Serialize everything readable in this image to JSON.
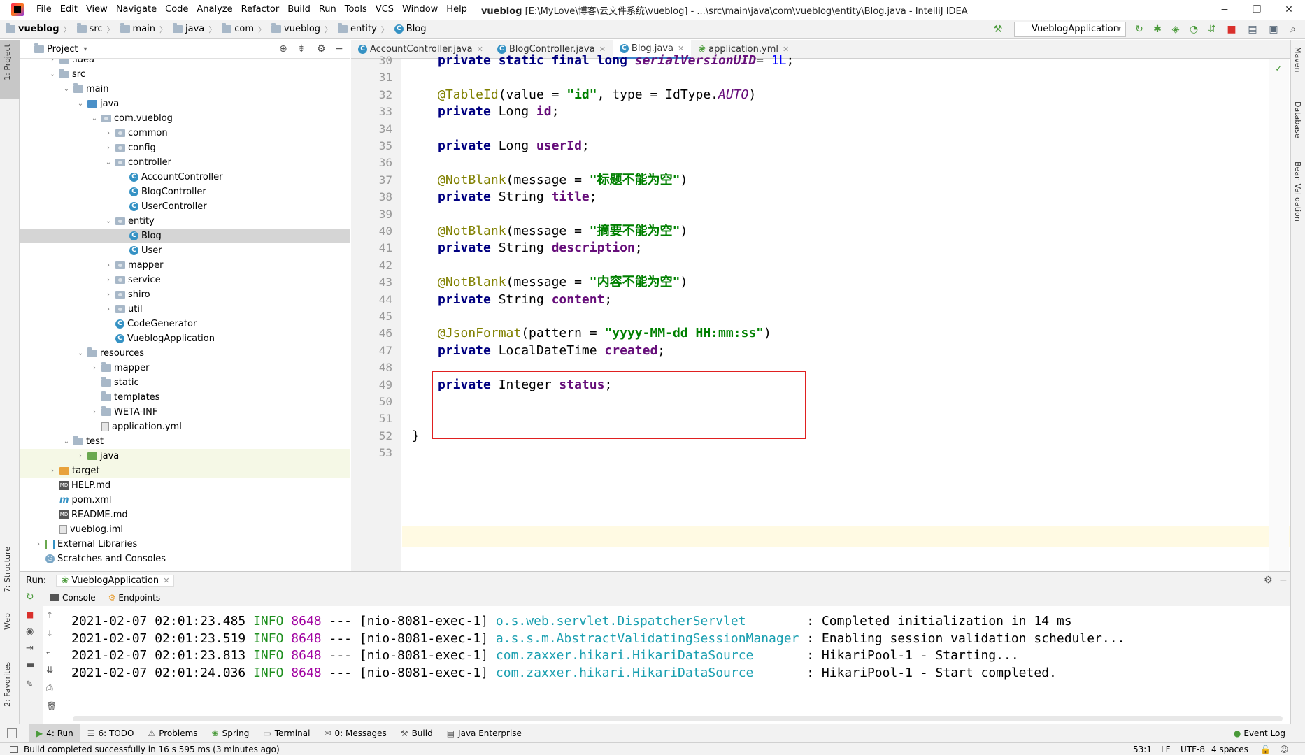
{
  "window": {
    "menu": [
      "File",
      "Edit",
      "View",
      "Navigate",
      "Code",
      "Analyze",
      "Refactor",
      "Build",
      "Run",
      "Tools",
      "VCS",
      "Window",
      "Help"
    ],
    "project_name": "vueblog",
    "title_path": "[E:\\MyLove\\博客\\云文件系统\\vueblog] - ...\\src\\main\\java\\com\\vueblog\\entity\\Blog.java - IntelliJ IDEA",
    "controls": [
      "−",
      "❐",
      "✕"
    ]
  },
  "breadcrumbs": [
    "vueblog",
    "src",
    "main",
    "java",
    "com",
    "vueblog",
    "entity",
    "Blog"
  ],
  "run_config": "VueblogApplication",
  "left_strip": {
    "project": "1: Project",
    "structure": "7: Structure",
    "web": "Web",
    "favorites": "2: Favorites"
  },
  "right_strip": {
    "maven": "Maven",
    "database": "Database",
    "bean": "Bean Validation"
  },
  "project_panel": {
    "title": "Project",
    "tree": [
      {
        "label": ".idea",
        "depth": 1,
        "arrow": "right",
        "icon": "folder"
      },
      {
        "label": "src",
        "depth": 1,
        "arrow": "down",
        "icon": "folder"
      },
      {
        "label": "main",
        "depth": 2,
        "arrow": "down",
        "icon": "folder"
      },
      {
        "label": "java",
        "depth": 3,
        "arrow": "down",
        "icon": "src"
      },
      {
        "label": "com.vueblog",
        "depth": 4,
        "arrow": "down",
        "icon": "pkg"
      },
      {
        "label": "common",
        "depth": 5,
        "arrow": "right",
        "icon": "pkg"
      },
      {
        "label": "config",
        "depth": 5,
        "arrow": "right",
        "icon": "pkg"
      },
      {
        "label": "controller",
        "depth": 5,
        "arrow": "down",
        "icon": "pkg"
      },
      {
        "label": "AccountController",
        "depth": 6,
        "arrow": "none",
        "icon": "class"
      },
      {
        "label": "BlogController",
        "depth": 6,
        "arrow": "none",
        "icon": "class"
      },
      {
        "label": "UserController",
        "depth": 6,
        "arrow": "none",
        "icon": "class"
      },
      {
        "label": "entity",
        "depth": 5,
        "arrow": "down",
        "icon": "pkg"
      },
      {
        "label": "Blog",
        "depth": 6,
        "arrow": "none",
        "icon": "class",
        "selected": true
      },
      {
        "label": "User",
        "depth": 6,
        "arrow": "none",
        "icon": "class"
      },
      {
        "label": "mapper",
        "depth": 5,
        "arrow": "right",
        "icon": "pkg"
      },
      {
        "label": "service",
        "depth": 5,
        "arrow": "right",
        "icon": "pkg"
      },
      {
        "label": "shiro",
        "depth": 5,
        "arrow": "right",
        "icon": "pkg"
      },
      {
        "label": "util",
        "depth": 5,
        "arrow": "right",
        "icon": "pkg"
      },
      {
        "label": "CodeGenerator",
        "depth": 5,
        "arrow": "none",
        "icon": "class"
      },
      {
        "label": "VueblogApplication",
        "depth": 5,
        "arrow": "none",
        "icon": "class"
      },
      {
        "label": "resources",
        "depth": 3,
        "arrow": "down",
        "icon": "folder"
      },
      {
        "label": "mapper",
        "depth": 4,
        "arrow": "right",
        "icon": "folder"
      },
      {
        "label": "static",
        "depth": 4,
        "arrow": "none",
        "icon": "folder"
      },
      {
        "label": "templates",
        "depth": 4,
        "arrow": "none",
        "icon": "folder"
      },
      {
        "label": "WETA-INF",
        "depth": 4,
        "arrow": "right",
        "icon": "folder"
      },
      {
        "label": "application.yml",
        "depth": 4,
        "arrow": "none",
        "icon": "file"
      },
      {
        "label": "test",
        "depth": 2,
        "arrow": "down",
        "icon": "folder"
      },
      {
        "label": "java",
        "depth": 3,
        "arrow": "right",
        "icon": "test",
        "highlight": true
      },
      {
        "label": "target",
        "depth": 1,
        "arrow": "right",
        "icon": "target",
        "highlight": true
      },
      {
        "label": "HELP.md",
        "depth": 1,
        "arrow": "none",
        "icon": "md"
      },
      {
        "label": "pom.xml",
        "depth": 1,
        "arrow": "none",
        "icon": "m"
      },
      {
        "label": "README.md",
        "depth": 1,
        "arrow": "none",
        "icon": "md"
      },
      {
        "label": "vueblog.iml",
        "depth": 1,
        "arrow": "none",
        "icon": "file"
      },
      {
        "label": "External Libraries",
        "depth": 0,
        "arrow": "right",
        "icon": "lib"
      },
      {
        "label": "Scratches and Consoles",
        "depth": 0,
        "arrow": "none",
        "icon": "scratch"
      }
    ]
  },
  "editor": {
    "tabs": [
      {
        "label": "AccountController.java",
        "active": false,
        "icon": "class"
      },
      {
        "label": "BlogController.java",
        "active": false,
        "icon": "class"
      },
      {
        "label": "Blog.java",
        "active": true,
        "icon": "class"
      },
      {
        "label": "application.yml",
        "active": false,
        "icon": "yml"
      }
    ],
    "lines": [
      {
        "n": "30",
        "tokens": [
          [
            "kw",
            "private static final long "
          ],
          [
            "fldi",
            "serialVersionUID"
          ],
          [
            "",
            "= "
          ],
          [
            "num",
            "1L"
          ],
          [
            "",
            ";"
          ]
        ]
      },
      {
        "n": "31",
        "tokens": []
      },
      {
        "n": "32",
        "tokens": [
          [
            "ann",
            "@TableId"
          ],
          [
            "",
            "(value = "
          ],
          [
            "str",
            "\"id\""
          ],
          [
            "",
            ", type = IdType."
          ],
          [
            "enm",
            "AUTO"
          ],
          [
            "",
            ")"
          ]
        ]
      },
      {
        "n": "33",
        "tokens": [
          [
            "kw",
            "private "
          ],
          [
            "",
            "Long "
          ],
          [
            "fld",
            "id"
          ],
          [
            "",
            ";"
          ]
        ]
      },
      {
        "n": "34",
        "tokens": []
      },
      {
        "n": "35",
        "tokens": [
          [
            "kw",
            "private "
          ],
          [
            "",
            "Long "
          ],
          [
            "fld",
            "userId"
          ],
          [
            "",
            ";"
          ]
        ]
      },
      {
        "n": "36",
        "tokens": []
      },
      {
        "n": "37",
        "tokens": [
          [
            "ann",
            "@NotBlank"
          ],
          [
            "",
            "(message = "
          ],
          [
            "str",
            "\"标题不能为空\""
          ],
          [
            "",
            ")"
          ]
        ]
      },
      {
        "n": "38",
        "tokens": [
          [
            "kw",
            "private "
          ],
          [
            "",
            "String "
          ],
          [
            "fld",
            "title"
          ],
          [
            "",
            ";"
          ]
        ]
      },
      {
        "n": "39",
        "tokens": []
      },
      {
        "n": "40",
        "tokens": [
          [
            "ann",
            "@NotBlank"
          ],
          [
            "",
            "(message = "
          ],
          [
            "str",
            "\"摘要不能为空\""
          ],
          [
            "",
            ")"
          ]
        ]
      },
      {
        "n": "41",
        "tokens": [
          [
            "kw",
            "private "
          ],
          [
            "",
            "String "
          ],
          [
            "fld",
            "description"
          ],
          [
            "",
            ";"
          ]
        ]
      },
      {
        "n": "42",
        "tokens": []
      },
      {
        "n": "43",
        "tokens": [
          [
            "ann",
            "@NotBlank"
          ],
          [
            "",
            "(message = "
          ],
          [
            "str",
            "\"内容不能为空\""
          ],
          [
            "",
            ")"
          ]
        ]
      },
      {
        "n": "44",
        "tokens": [
          [
            "kw",
            "private "
          ],
          [
            "",
            "String "
          ],
          [
            "fld",
            "content"
          ],
          [
            "",
            ";"
          ]
        ]
      },
      {
        "n": "45",
        "tokens": []
      },
      {
        "n": "46",
        "tokens": [
          [
            "ann",
            "@JsonFormat"
          ],
          [
            "",
            "(pattern = "
          ],
          [
            "str",
            "\"yyyy-MM-dd HH:mm:ss\""
          ],
          [
            "",
            ")"
          ]
        ]
      },
      {
        "n": "47",
        "tokens": [
          [
            "kw",
            "private "
          ],
          [
            "",
            "LocalDateTime "
          ],
          [
            "fld",
            "created"
          ],
          [
            "",
            ";"
          ]
        ]
      },
      {
        "n": "48",
        "tokens": []
      },
      {
        "n": "49",
        "tokens": [
          [
            "kw",
            "private "
          ],
          [
            "",
            "Integer "
          ],
          [
            "fld",
            "status"
          ],
          [
            "",
            ";"
          ]
        ]
      },
      {
        "n": "50",
        "tokens": []
      },
      {
        "n": "51",
        "tokens": []
      },
      {
        "n": "52",
        "tokens": [
          [
            "",
            "}"
          ]
        ],
        "outdent": true
      },
      {
        "n": "53",
        "tokens": [],
        "caret": true
      }
    ]
  },
  "run_panel": {
    "label": "Run:",
    "config_tab": "VueblogApplication",
    "tabs": [
      "Console",
      "Endpoints"
    ],
    "logs": [
      {
        "time": "2021-02-07 02:01:23.485",
        "level": "INFO",
        "pid": "8648",
        "thread": "--- [nio-8081-exec-1]",
        "cls": "o.s.web.servlet.DispatcherServlet       ",
        "msg": ": Completed initialization in 14 ms"
      },
      {
        "time": "2021-02-07 02:01:23.519",
        "level": "INFO",
        "pid": "8648",
        "thread": "--- [nio-8081-exec-1]",
        "cls": "a.s.s.m.AbstractValidatingSessionManager",
        "msg": ": Enabling session validation scheduler..."
      },
      {
        "time": "2021-02-07 02:01:23.813",
        "level": "INFO",
        "pid": "8648",
        "thread": "--- [nio-8081-exec-1]",
        "cls": "com.zaxxer.hikari.HikariDataSource      ",
        "msg": ": HikariPool-1 - Starting..."
      },
      {
        "time": "2021-02-07 02:01:24.036",
        "level": "INFO",
        "pid": "8648",
        "thread": "--- [nio-8081-exec-1]",
        "cls": "com.zaxxer.hikari.HikariDataSource      ",
        "msg": ": HikariPool-1 - Start completed."
      }
    ]
  },
  "bottom_tabs": [
    "4: Run",
    "6: TODO",
    "Problems",
    "Spring",
    "Terminal",
    "0: Messages",
    "Build",
    "Java Enterprise"
  ],
  "event_log": "Event Log",
  "status": {
    "message": "Build completed successfully in 16 s 595 ms (3 minutes ago)",
    "position": "53:1",
    "line_sep": "LF",
    "encoding": "UTF-8",
    "indent": "4 spaces"
  },
  "colors": {
    "accent": "#4083c9",
    "highlight_box": "#e02020",
    "selected_row": "#d5d5d5",
    "caret_row": "#fffae3"
  }
}
